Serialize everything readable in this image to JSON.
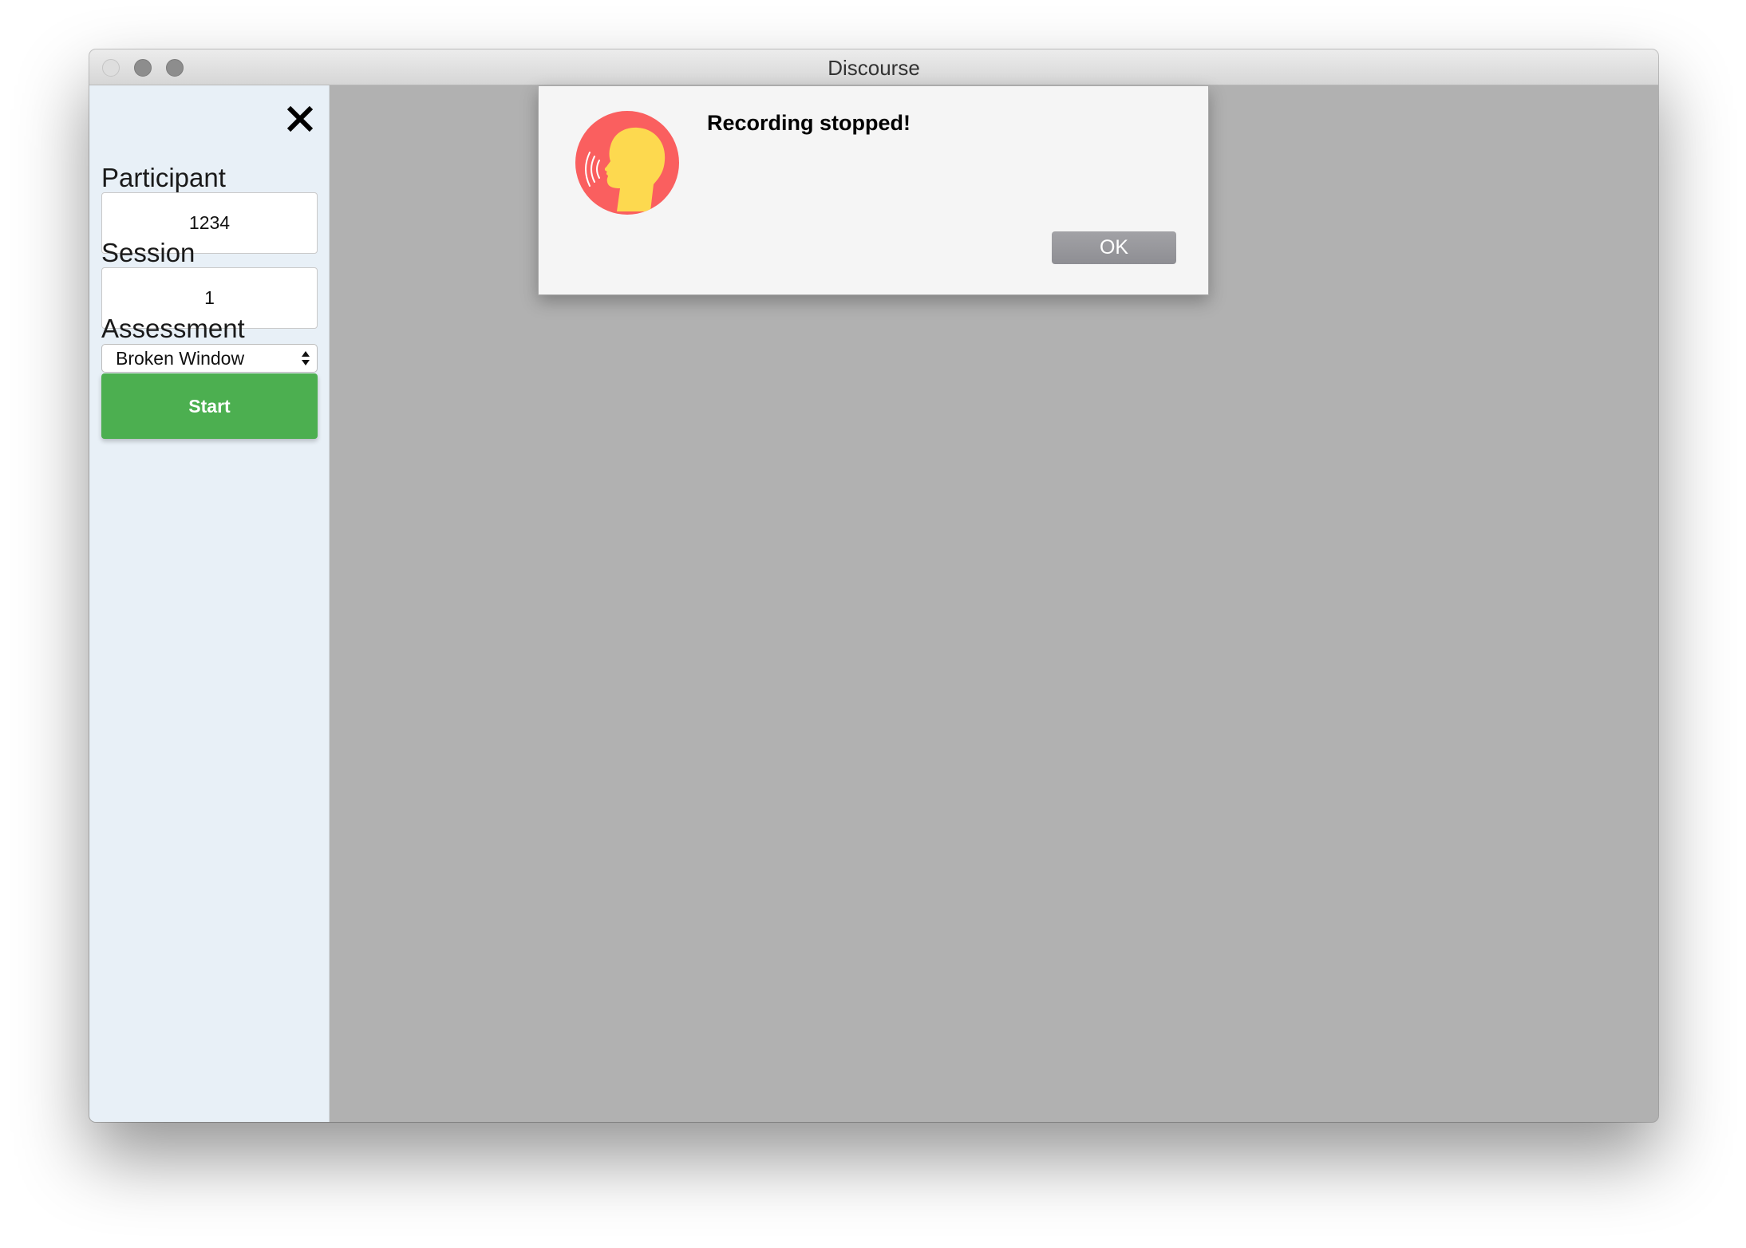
{
  "window": {
    "title": "Discourse"
  },
  "sidebar": {
    "close_icon": "close-x-icon",
    "participant": {
      "label": "Participant",
      "value": "1234"
    },
    "session": {
      "label": "Session",
      "value": "1"
    },
    "assessment": {
      "label": "Assessment",
      "selected": "Broken Window"
    },
    "start_label": "Start"
  },
  "dialog": {
    "icon": "speaking-head-icon",
    "message": "Recording stopped!",
    "ok_label": "OK"
  },
  "colors": {
    "start_button": "#4caf50",
    "sidebar_bg": "#e8f0f7",
    "overlay_bg": "#b1b1b1",
    "icon_circle": "#fa5f5f",
    "icon_head": "#fdd94f"
  }
}
